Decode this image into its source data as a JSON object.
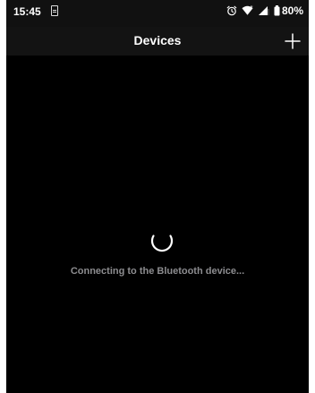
{
  "status_bar": {
    "time": "15:45",
    "battery_percent": "80%",
    "icons": [
      "sim-card-icon",
      "alarm-icon",
      "wifi-icon",
      "cellular-signal-icon",
      "battery-icon"
    ]
  },
  "header": {
    "title": "Devices",
    "add_icon": "plus-icon"
  },
  "main": {
    "loading_message": "Connecting to the Bluetooth device...",
    "spinner_icon": "loading-spinner-icon"
  },
  "colors": {
    "background": "#000000",
    "header_background": "#131313",
    "title_text": "#ffffff",
    "message_text": "#8c8c8f"
  }
}
